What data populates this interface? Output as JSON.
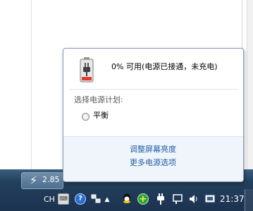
{
  "popup": {
    "battery_status": "0% 可用(电源已接通，未充电)",
    "plan_section_label": "选择电源计划:",
    "plan_option": "平衡",
    "links": {
      "adjust_brightness": "调整屏幕亮度",
      "more_power_options": "更多电源选项"
    }
  },
  "taskbar": {
    "task_button_text": "2.85",
    "language": "CH",
    "clock": "21:37",
    "tray_icons": [
      "keyboard-icon",
      "help-icon",
      "network-icon",
      "show-hidden-icons-arrow",
      "qq-icon",
      "plus-icon",
      "power-plug-icon",
      "action-center-flag-icon",
      "volume-icon",
      "tray-icon"
    ]
  }
}
